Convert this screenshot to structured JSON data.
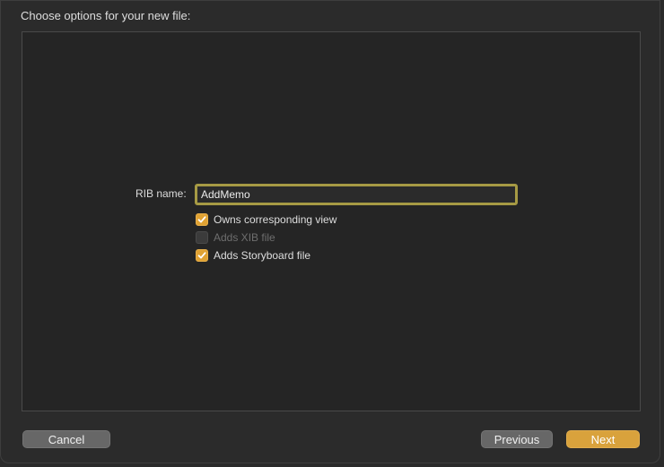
{
  "sheet": {
    "title": "Choose options for your new file:"
  },
  "form": {
    "rib_name_label": "RIB name:",
    "rib_name_value": "AddMemo",
    "options": [
      {
        "label": "Owns corresponding view",
        "checked": true,
        "enabled": true
      },
      {
        "label": "Adds XIB file",
        "checked": false,
        "enabled": false
      },
      {
        "label": "Adds Storyboard file",
        "checked": true,
        "enabled": true
      }
    ]
  },
  "buttons": {
    "cancel": "Cancel",
    "previous": "Previous",
    "next": "Next"
  },
  "colors": {
    "accent": "#e0a233",
    "focus_ring": "#a69a44",
    "background": "#2b2b2b"
  }
}
